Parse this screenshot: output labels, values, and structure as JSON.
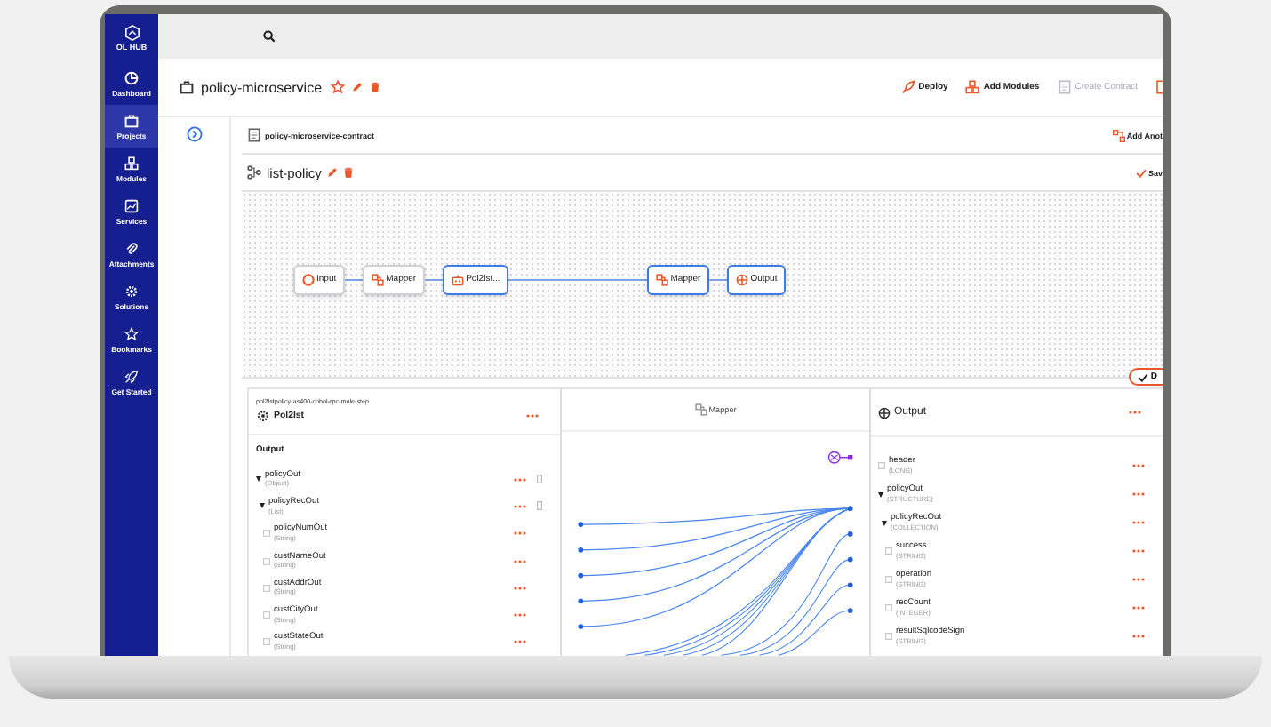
{
  "sidebar": {
    "logo": "OL HUB",
    "items": [
      {
        "label": "Dashboard",
        "selected": false
      },
      {
        "label": "Projects",
        "selected": true
      },
      {
        "label": "Modules",
        "selected": false
      },
      {
        "label": "Services",
        "selected": false
      },
      {
        "label": "Attachments",
        "selected": false
      },
      {
        "label": "Solutions",
        "selected": false
      },
      {
        "label": "Bookmarks",
        "selected": false
      },
      {
        "label": "Get Started",
        "selected": false
      }
    ]
  },
  "header": {
    "title": "policy-microservice",
    "actions": [
      {
        "label": "Deploy",
        "disabled": false
      },
      {
        "label": "Add Modules",
        "disabled": false
      },
      {
        "label": "Create Contract",
        "disabled": true
      }
    ]
  },
  "contract": {
    "name": "policy-microservice-contract",
    "action": "Add Anot"
  },
  "flow": {
    "name": "list-policy",
    "save": "Sav",
    "done": "D",
    "nodes": [
      {
        "label": "Input",
        "selected": false,
        "kind": "input"
      },
      {
        "label": "Mapper",
        "selected": false,
        "kind": "mapper"
      },
      {
        "label": "Pol2lst...",
        "selected": true,
        "kind": "program"
      },
      {
        "label": "Mapper",
        "selected": true,
        "kind": "mapper"
      },
      {
        "label": "Output",
        "selected": true,
        "kind": "output"
      }
    ]
  },
  "source_panel": {
    "path": "pol2lstpolicy-as400-cobol-rpc-mule-step",
    "title": "Pol2lst",
    "section": "Output",
    "fields": [
      {
        "name": "policyOut",
        "type": "(Object)",
        "kind": "group",
        "children": [
          {
            "name": "policyRecOut",
            "type": "(List)",
            "kind": "group",
            "children": [
              {
                "name": "policyNumOut",
                "type": "(String)",
                "kind": "field"
              },
              {
                "name": "custNameOut",
                "type": "(String)",
                "kind": "field"
              },
              {
                "name": "custAddrOut",
                "type": "(String)",
                "kind": "field"
              },
              {
                "name": "custCityOut",
                "type": "(String)",
                "kind": "field"
              },
              {
                "name": "custStateOut",
                "type": "(String)",
                "kind": "field"
              }
            ]
          }
        ]
      }
    ]
  },
  "mapper_panel": {
    "title": "Mapper"
  },
  "target_panel": {
    "title": "Output",
    "fields": [
      {
        "name": "header",
        "type": "(LONG)",
        "kind": "field"
      },
      {
        "name": "policyOut",
        "type": "(STRUCTURE)",
        "kind": "group",
        "children": [
          {
            "name": "policyRecOut",
            "type": "(COLLECTION)",
            "kind": "group",
            "children": [
              {
                "name": "success",
                "type": "(STRING)",
                "kind": "field"
              },
              {
                "name": "operation",
                "type": "(STRING)",
                "kind": "field"
              },
              {
                "name": "recCount",
                "type": "(INTEGER)",
                "kind": "field"
              },
              {
                "name": "resultSqlcodeSign",
                "type": "(STRING)",
                "kind": "field"
              }
            ]
          }
        ]
      }
    ]
  }
}
